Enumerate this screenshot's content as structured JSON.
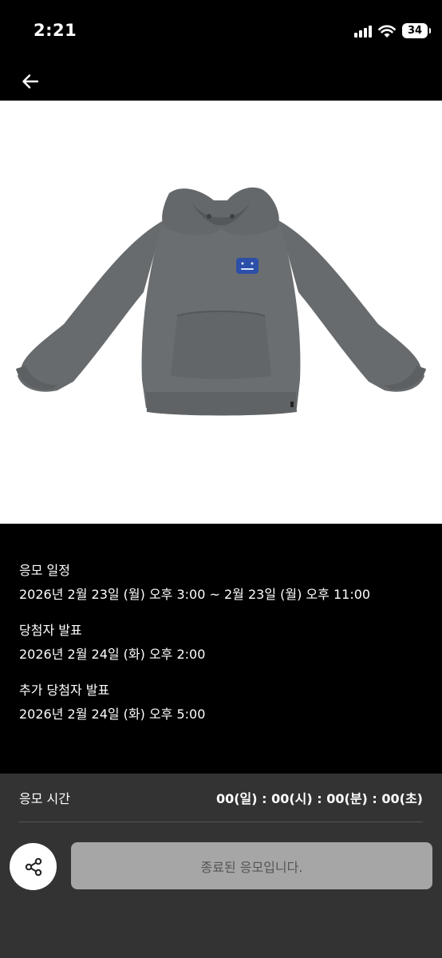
{
  "status_bar": {
    "time": "2:21",
    "battery": "34",
    "icons": [
      "signal-icon",
      "wifi-icon",
      "battery-icon"
    ]
  },
  "header": {
    "back_icon": "arrow-left-icon"
  },
  "product": {
    "image": "gray-hoodie-with-blue-patch"
  },
  "schedule": {
    "entry": {
      "title": "응모 일정",
      "value": "2026년 2월 23일 (월) 오후 3:00 ~ 2월 23일 (월) 오후 11:00"
    },
    "announce": {
      "title": "당첨자 발표",
      "value": "2026년 2월 24일 (화) 오후 2:00"
    },
    "extra_announce": {
      "title": "추가 당첨자 발표",
      "value": "2026년 2월 24일 (화) 오후 5:00"
    }
  },
  "countdown": {
    "label": "응모 시간",
    "value": "00(일) : 00(시) : 00(분) : 00(초)"
  },
  "actions": {
    "share_icon": "share-icon",
    "apply_label": "종료된 응모입니다."
  },
  "colors": {
    "background": "#000000",
    "panel": "#333333",
    "disabled_button": "#a6a6a6",
    "hoodie": "#6b6e70",
    "patch": "#2c4fa8"
  }
}
